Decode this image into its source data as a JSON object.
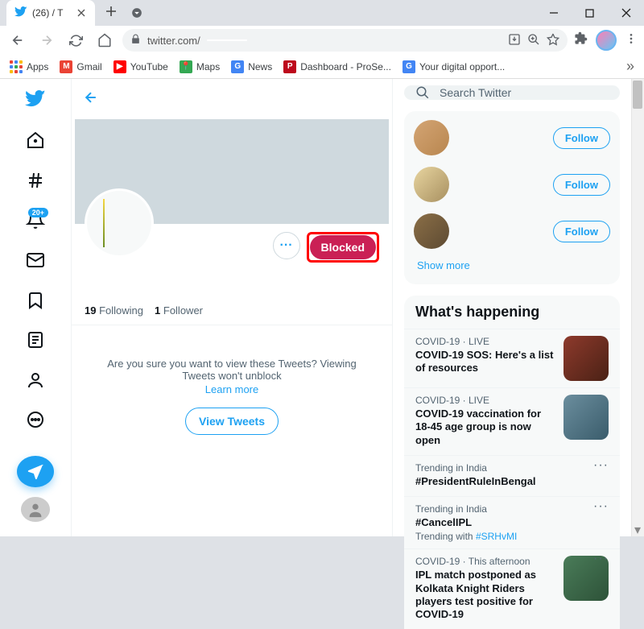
{
  "browser": {
    "tab": {
      "favicon_color": "#1da1f2",
      "title": "(26)                         / T"
    },
    "url_host": "twitter.com/",
    "url_path": "",
    "bookmarks": [
      {
        "label": "Apps",
        "kind": "apps"
      },
      {
        "label": "Gmail",
        "color": "#ea4335",
        "letter": "M"
      },
      {
        "label": "YouTube",
        "color": "#ff0000",
        "letter": "▶"
      },
      {
        "label": "Maps",
        "color": "#34a853",
        "letter": "📍"
      },
      {
        "label": "News",
        "color": "#4285f4",
        "letter": "G"
      },
      {
        "label": "Dashboard - ProSe...",
        "color": "#bd081c",
        "letter": "P"
      },
      {
        "label": "Your digital opport...",
        "color": "#4285f4",
        "letter": "G"
      }
    ]
  },
  "twitter": {
    "notif_badge": "20+",
    "search_placeholder": "Search Twitter",
    "profile": {
      "following_count": "19",
      "following_label": "Following",
      "followers_count": "1",
      "followers_label": "Follower",
      "blocked_label": "Blocked",
      "blocked_message": "Are you sure you want to view these Tweets? Viewing Tweets won't unblock",
      "learn_more": "Learn more",
      "view_tweets": "View Tweets"
    },
    "who_to_follow": {
      "follow_label": "Follow",
      "show_more": "Show more"
    },
    "happening": {
      "header": "What's happening",
      "trends": [
        {
          "meta": "COVID-19 · LIVE",
          "title": "COVID-19 SOS: Here's a list of resources",
          "has_thumb": true,
          "thumb": "t1"
        },
        {
          "meta": "COVID-19 · LIVE",
          "title": "COVID-19 vaccination for 18-45 age group is now open",
          "has_thumb": true,
          "thumb": "t2"
        },
        {
          "meta": "Trending in India",
          "title": "#PresidentRuleInBengal",
          "has_more": true
        },
        {
          "meta": "Trending in India",
          "title": "#CancelIPL",
          "sub_pre": "Trending with ",
          "sub_link": "#SRHvMI",
          "has_more": true
        },
        {
          "meta": "COVID-19 · This afternoon",
          "title": "IPL match postponed as Kolkata Knight Riders players test positive for COVID-19",
          "has_thumb": true,
          "thumb": "t3",
          "has_more": true
        }
      ]
    }
  }
}
